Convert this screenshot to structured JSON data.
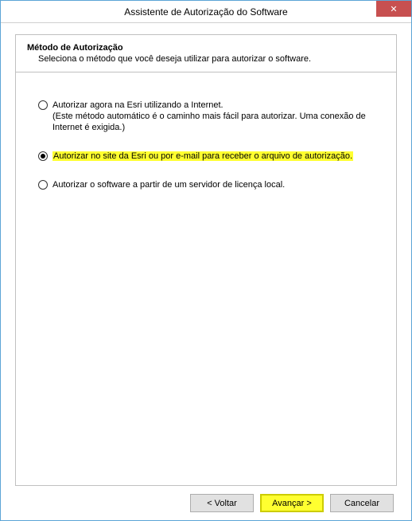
{
  "window": {
    "title": "Assistente de Autorização do Software",
    "close_glyph": "✕"
  },
  "header": {
    "heading": "Método de Autorização",
    "subheading": "Seleciona o método que você deseja utilizar para autorizar o software."
  },
  "options": {
    "opt1": {
      "label": "Autorizar agora na Esri utilizando a Internet.",
      "sub": "(Este método automático é o caminho mais fácil para autorizar. Uma conexão de Internet é exigida.)"
    },
    "opt2": {
      "label": "Autorizar no site da Esri ou por e-mail para receber o arquivo de autorização."
    },
    "opt3": {
      "label": "Autorizar o software a partir de um servidor de licença local."
    },
    "selected": "opt2"
  },
  "buttons": {
    "back": "< Voltar",
    "next": "Avançar >",
    "cancel": "Cancelar"
  }
}
